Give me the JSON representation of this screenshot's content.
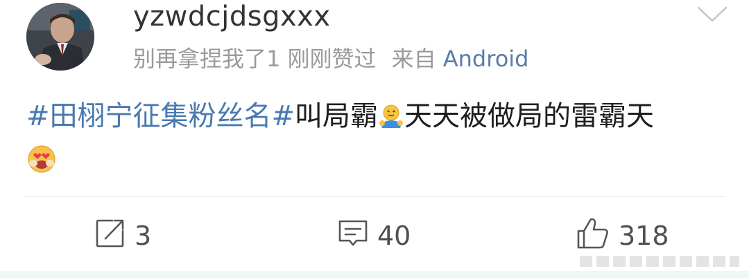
{
  "post": {
    "username": "yzwdcjdsgxxx",
    "liked_by": "别再拿捏我了1",
    "liked_time": "刚刚赞过",
    "source_label": "来自",
    "source_app": "Android",
    "content": {
      "topic": "#田栩宁征集粉丝名#",
      "text_before_emoji": "叫局霸",
      "text_after_emoji": "天天被做局的雷霸天"
    },
    "emojis": [
      "hug-emoji",
      "heart-eyes-emoji"
    ]
  },
  "actions": {
    "repost_count": "3",
    "comment_count": "40",
    "like_count": "318"
  },
  "colors": {
    "topic": "#4a79b0",
    "source_app": "#5a7ca8",
    "meta": "#9a9a9a",
    "text": "#1e1e1e"
  }
}
